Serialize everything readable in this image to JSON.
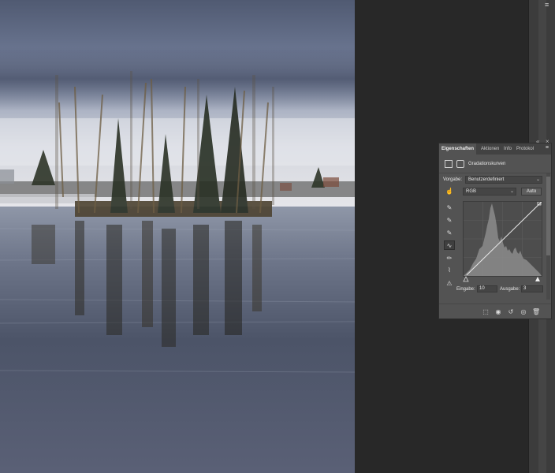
{
  "panel": {
    "tabs": [
      "Eigenschaften",
      "Aktionen",
      "Info",
      "Protokol"
    ],
    "title": "Gradationskurven",
    "preset_label": "Vorgabe:",
    "preset_value": "Benutzerdefiniert",
    "channel_value": "RGB",
    "auto_label": "Auto",
    "input_label": "Eingabe:",
    "input_value": "10",
    "output_label": "Ausgabe:",
    "output_value": "3",
    "curve_points": [
      [
        10,
        3
      ],
      [
        255,
        255
      ]
    ]
  },
  "icons": {
    "panel_menu": "menu-icon",
    "collapse": "double-chevron-right-icon",
    "close": "close-icon"
  },
  "colors": {
    "workspace": "#282828",
    "panel": "#535353",
    "tab_bar": "#424242"
  }
}
